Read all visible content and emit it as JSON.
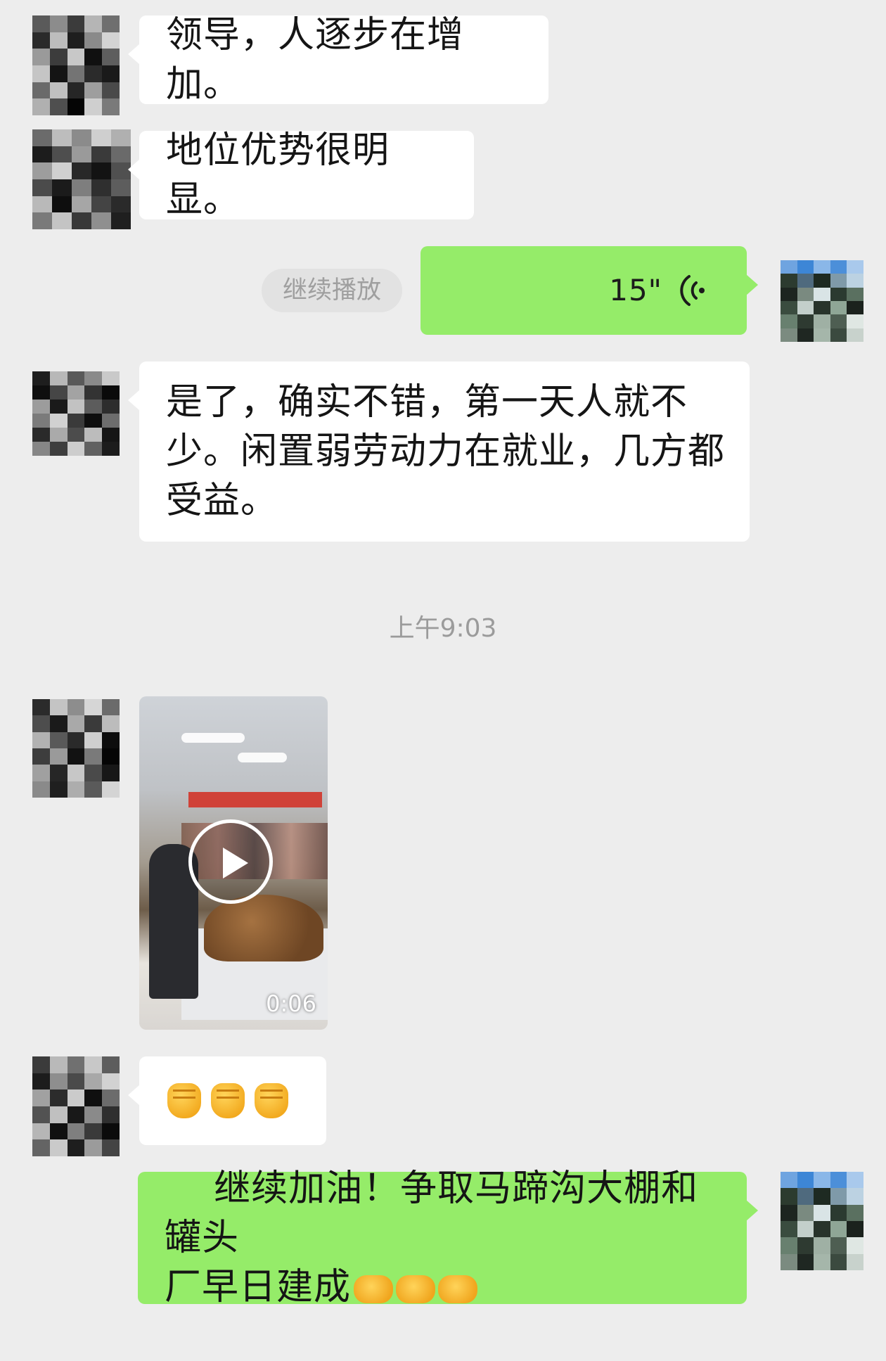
{
  "chat": {
    "messages": [
      {
        "side": "left",
        "type": "text",
        "text": "领导，人逐步在增加。"
      },
      {
        "side": "left",
        "type": "text",
        "text": "地位优势很明显。"
      },
      {
        "side": "right",
        "type": "voice",
        "duration": "15\"",
        "action": "继续播放"
      },
      {
        "side": "left",
        "type": "text",
        "text": "是了，确实不错，第一天人就不\n少。闲置弱劳动力在就业，几方都\n受益。"
      },
      {
        "type": "timestamp",
        "text": "上午9:03"
      },
      {
        "side": "left",
        "type": "video",
        "duration": "0:06"
      },
      {
        "side": "left",
        "type": "emoji",
        "emoji": "fist-icon x3"
      },
      {
        "side": "right",
        "type": "text",
        "text": "继续加油！争取马蹄沟大棚和罐头\n厂早日建成",
        "trailing_emoji": "handshake-icon x3"
      }
    ]
  },
  "colors": {
    "background": "#ededed",
    "left_bubble": "#ffffff",
    "right_bubble": "#95ec69",
    "timestamp_text": "#9b9b9b"
  }
}
